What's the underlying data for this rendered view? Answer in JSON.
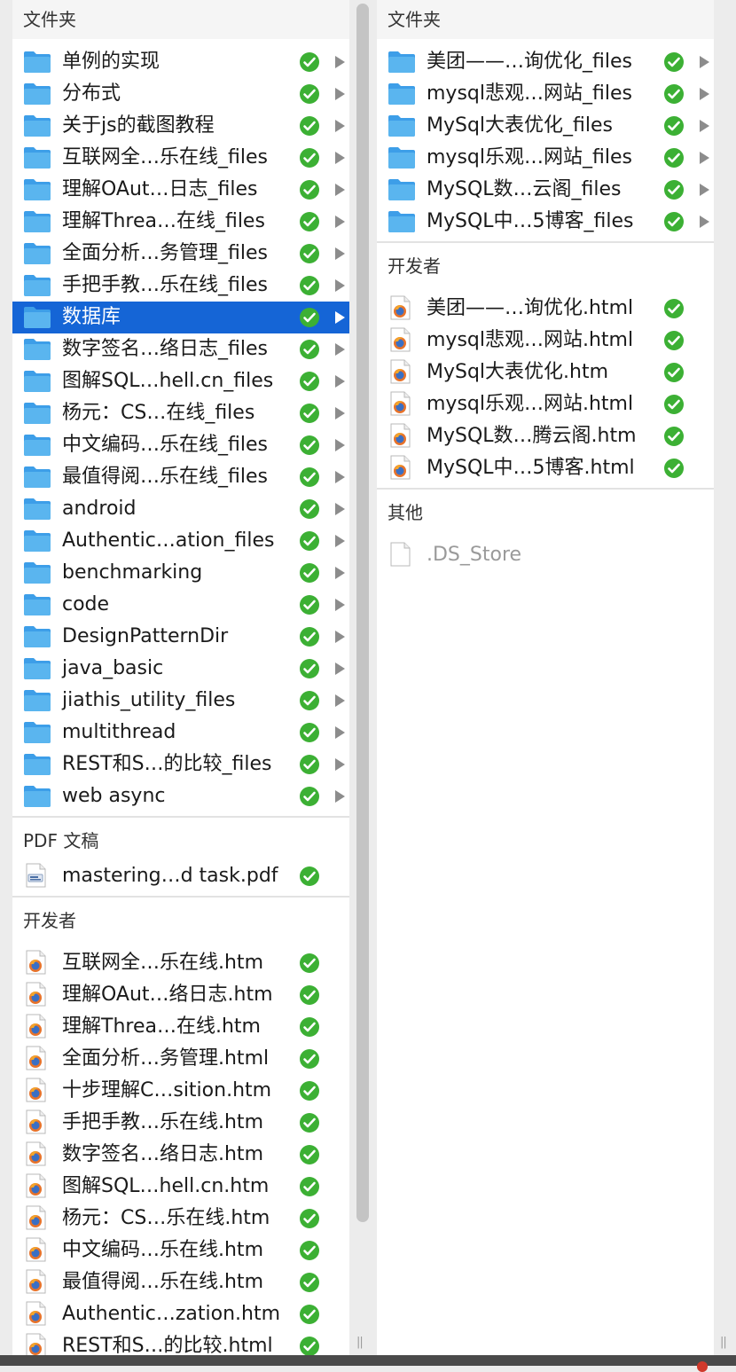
{
  "colors": {
    "selection": "#1565d6",
    "badge_green": "#3cb034",
    "folder_blue": "#5ab5ef"
  },
  "left": {
    "header_folders": "文件夹",
    "folders": [
      {
        "label": "单例的实现",
        "selected": false
      },
      {
        "label": "分布式",
        "selected": false
      },
      {
        "label": "关于js的截图教程",
        "selected": false
      },
      {
        "label": "互联网全…乐在线_files",
        "selected": false
      },
      {
        "label": "理解OAut…日志_files",
        "selected": false
      },
      {
        "label": "理解Threa…在线_files",
        "selected": false
      },
      {
        "label": "全面分析…务管理_files",
        "selected": false
      },
      {
        "label": "手把手教…乐在线_files",
        "selected": false
      },
      {
        "label": "数据库",
        "selected": true
      },
      {
        "label": "数字签名…络日志_files",
        "selected": false
      },
      {
        "label": "图解SQL…hell.cn_files",
        "selected": false
      },
      {
        "label": "杨元：CS…在线_files",
        "selected": false
      },
      {
        "label": "中文编码…乐在线_files",
        "selected": false
      },
      {
        "label": "最值得阅…乐在线_files",
        "selected": false
      },
      {
        "label": "android",
        "selected": false
      },
      {
        "label": "Authentic…ation_files",
        "selected": false
      },
      {
        "label": "benchmarking",
        "selected": false
      },
      {
        "label": "code",
        "selected": false
      },
      {
        "label": "DesignPatternDir",
        "selected": false
      },
      {
        "label": "java_basic",
        "selected": false
      },
      {
        "label": "jiathis_utility_files",
        "selected": false
      },
      {
        "label": "multithread",
        "selected": false
      },
      {
        "label": "REST和S…的比较_files",
        "selected": false
      },
      {
        "label": "web async",
        "selected": false
      }
    ],
    "header_pdf": "PDF 文稿",
    "pdfs": [
      {
        "label": "mastering…d task.pdf"
      }
    ],
    "header_dev": "开发者",
    "dev_files": [
      {
        "label": "互联网全…乐在线.htm"
      },
      {
        "label": "理解OAut…络日志.htm"
      },
      {
        "label": "理解Threa…在线.htm"
      },
      {
        "label": "全面分析…务管理.html"
      },
      {
        "label": "十步理解C…sition.htm"
      },
      {
        "label": "手把手教…乐在线.htm"
      },
      {
        "label": "数字签名…络日志.htm"
      },
      {
        "label": "图解SQL…hell.cn.htm"
      },
      {
        "label": "杨元：CS…乐在线.htm"
      },
      {
        "label": "中文编码…乐在线.htm"
      },
      {
        "label": "最值得阅…乐在线.htm"
      },
      {
        "label": "Authentic…zation.htm"
      },
      {
        "label": "REST和S…的比较.html"
      }
    ]
  },
  "right": {
    "header_folders": "文件夹",
    "folders": [
      {
        "label": "美团——…询优化_files"
      },
      {
        "label": "mysql悲观…网站_files"
      },
      {
        "label": "MySql大表优化_files"
      },
      {
        "label": "mysql乐观…网站_files"
      },
      {
        "label": "MySQL数…云阁_files"
      },
      {
        "label": "MySQL中…5博客_files"
      }
    ],
    "header_dev": "开发者",
    "dev_files": [
      {
        "label": "美团——…询优化.html"
      },
      {
        "label": "mysql悲观…网站.html"
      },
      {
        "label": "MySql大表优化.htm"
      },
      {
        "label": "mysql乐观…网站.html"
      },
      {
        "label": "MySQL数…腾云阁.htm"
      },
      {
        "label": "MySQL中…5博客.html"
      }
    ],
    "header_other": "其他",
    "other_files": [
      {
        "label": ".DS_Store"
      }
    ]
  }
}
